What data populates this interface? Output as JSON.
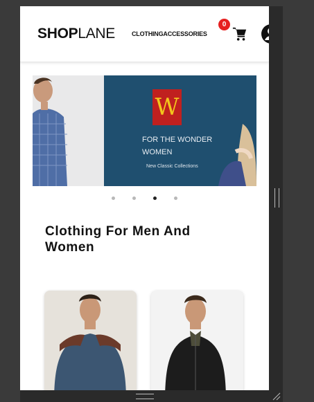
{
  "header": {
    "logo_bold": "SHOP",
    "logo_light": "LANE",
    "nav_clothing": "CLOTHING",
    "nav_accessories": "ACCESSORIES",
    "cart_count": "0",
    "cart_icon": "cart-icon",
    "account_icon": "user-icon"
  },
  "banner": {
    "brand_letter": "W",
    "headline_line1": "FOR THE WONDER",
    "headline_line2": "WOMEN",
    "subtext": "New Classic Collections",
    "dots_count": 4,
    "active_dot": 3
  },
  "section": {
    "title": "Clothing For Men And Women"
  },
  "colors": {
    "badge": "#e62020",
    "banner_bg": "#1f4f6f",
    "brand_red": "#c0201f",
    "brand_yellow": "#f3c61c"
  }
}
